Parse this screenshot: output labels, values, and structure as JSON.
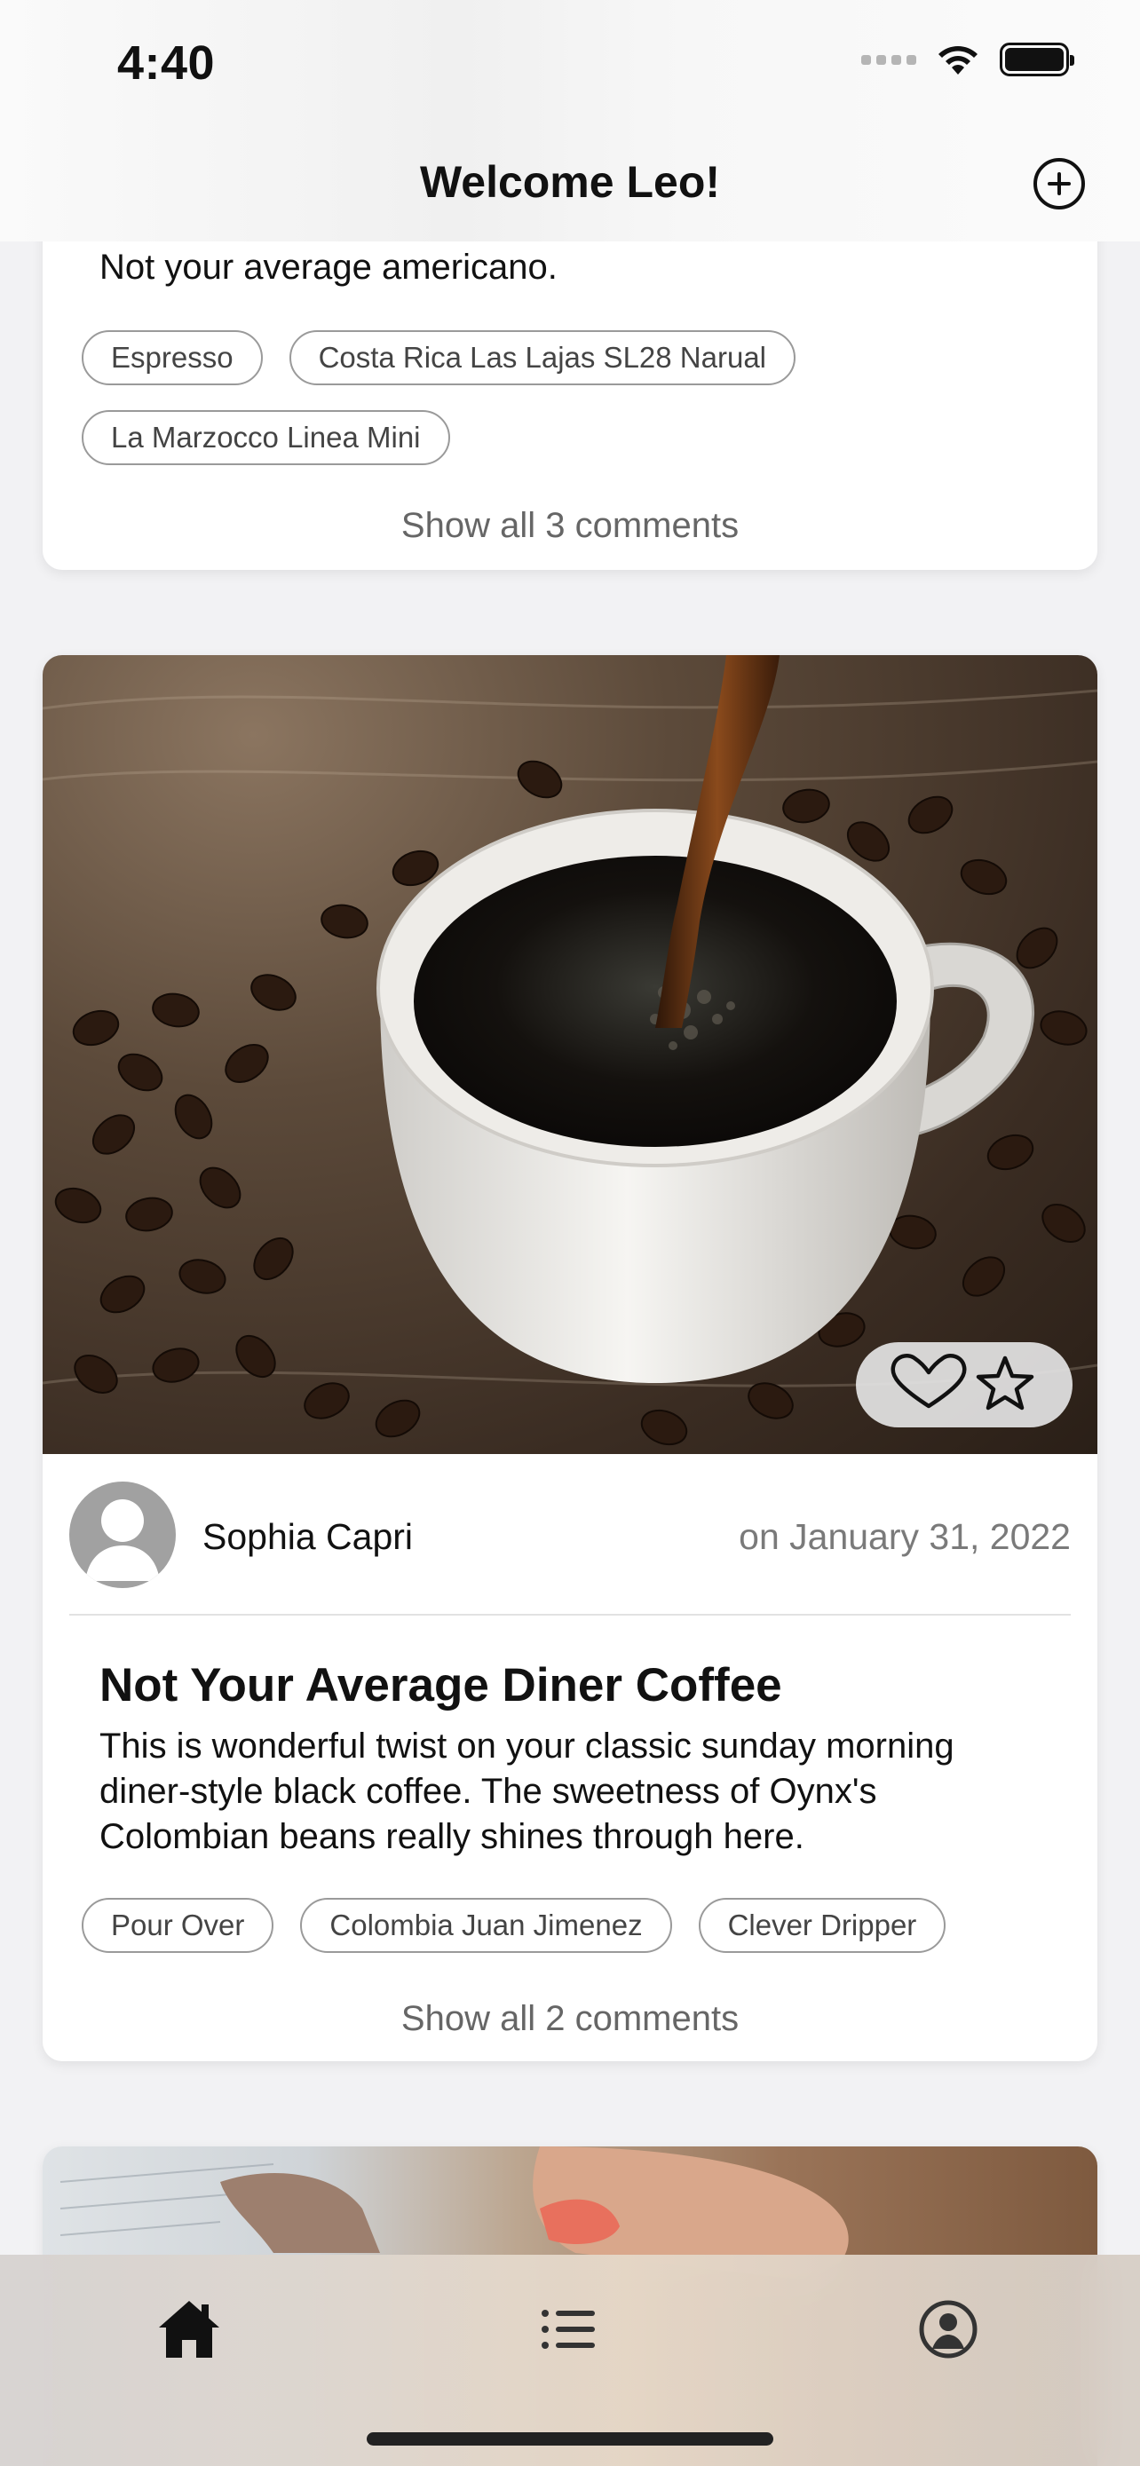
{
  "status_bar": {
    "time": "4:40"
  },
  "nav": {
    "title": "Welcome Leo!",
    "add_icon": "plus-circle-icon"
  },
  "posts": [
    {
      "description": "Not your average americano.",
      "tags": [
        "Espresso",
        "Costa Rica Las Lajas SL28 Narual",
        "La Marzocco Linea Mini"
      ],
      "comments_link": "Show all 3 comments"
    },
    {
      "image": "coffee-pour-cup-beans",
      "author": "Sophia Capri",
      "date": "on January 31, 2022",
      "title": "Not Your Average Diner Coffee",
      "description": "This is wonderful twist on your classic sunday morning diner-style black coffee. The sweetness of Oynx's Colombian beans really shines through here.",
      "tags": [
        "Pour Over",
        "Colombia Juan Jimenez",
        "Clever Dripper"
      ],
      "comments_link": "Show all 2 comments",
      "actions": {
        "like_icon": "heart-icon",
        "favorite_icon": "star-icon"
      }
    },
    {
      "image": "hand-holding-coffee-on-newspaper"
    }
  ],
  "tab_bar": {
    "items": [
      {
        "icon": "home-icon",
        "active": true
      },
      {
        "icon": "list-icon",
        "active": false
      },
      {
        "icon": "profile-icon",
        "active": false
      }
    ]
  }
}
